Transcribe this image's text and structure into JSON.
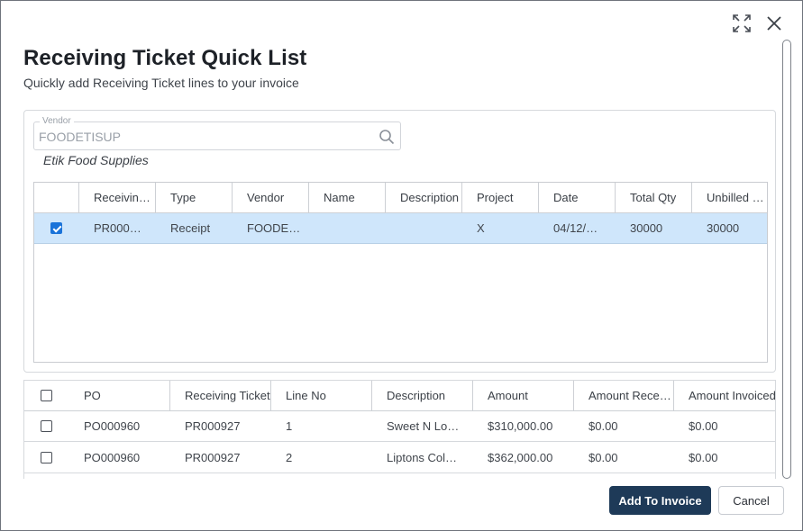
{
  "dialog": {
    "title": "Receiving Ticket Quick List",
    "subtitle": "Quickly add Receiving Ticket lines to your invoice",
    "icons": {
      "expand": "expand-icon",
      "close": "close-icon"
    }
  },
  "vendor": {
    "label": "Vendor",
    "value": "FOODETISUP",
    "name": "Etik Food Supplies",
    "search_icon": "search-icon"
  },
  "tickets_table": {
    "columns": [
      "Receiving Nu",
      "Type",
      "Vendor",
      "Name",
      "Description",
      "Project",
      "Date",
      "Total Qty",
      "Unbilled Qua"
    ],
    "rows": [
      {
        "checked": true,
        "cells": [
          "PR000…",
          "Receipt",
          "FOODE…",
          "",
          "",
          "X",
          "04/12/…",
          "30000",
          "30000"
        ]
      }
    ]
  },
  "lines_table": {
    "columns": [
      "PO",
      "Receiving Ticket",
      "Line No",
      "Description",
      "Amount",
      "Amount Received",
      "Amount Invoiced"
    ],
    "rows": [
      {
        "checked": false,
        "cells": [
          "PO000960",
          "PR000927",
          "1",
          "Sweet N Lo…",
          "$310,000.00",
          "$0.00",
          "$0.00"
        ]
      },
      {
        "checked": false,
        "cells": [
          "PO000960",
          "PR000927",
          "2",
          "Liptons Cold…",
          "$362,000.00",
          "$0.00",
          "$0.00"
        ]
      }
    ]
  },
  "footer": {
    "add_label": "Add To Invoice",
    "cancel_label": "Cancel"
  },
  "colors": {
    "primary_button": "#1e3a58",
    "selected_row": "#cfe6fb",
    "checkbox_checked": "#1a73d9"
  }
}
